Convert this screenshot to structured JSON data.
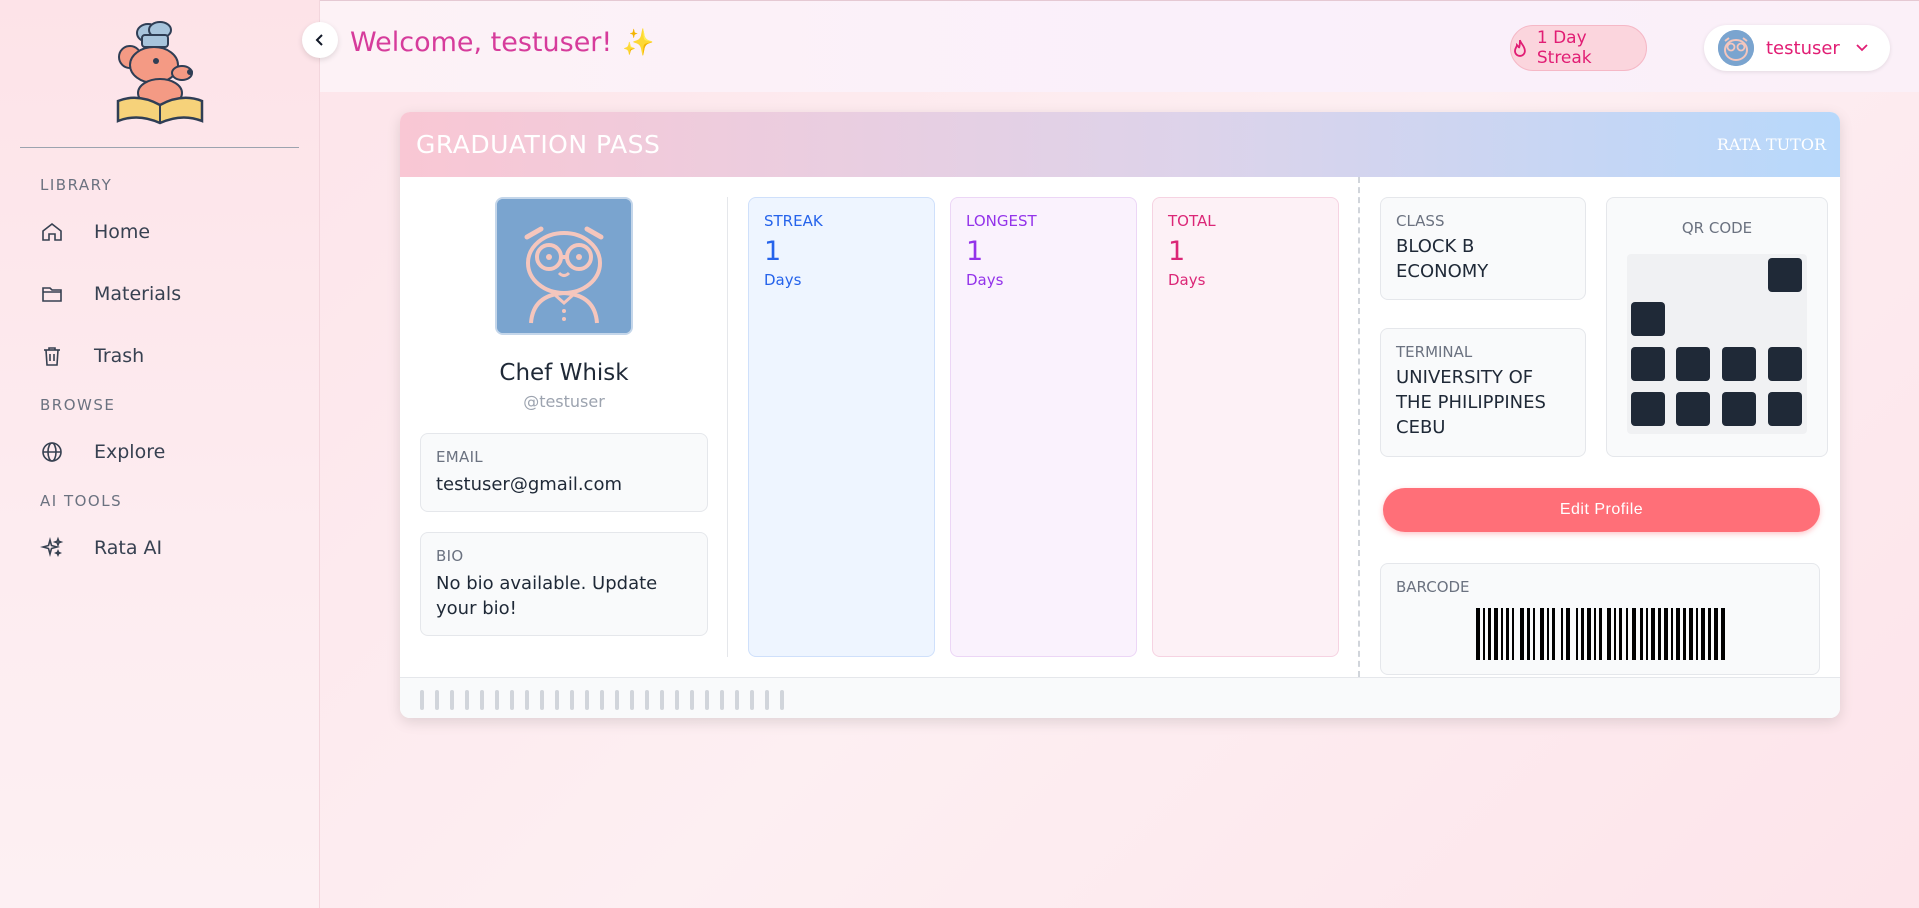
{
  "sidebar": {
    "sections": [
      {
        "heading": "LIBRARY",
        "items": [
          {
            "label": "Home",
            "icon": "home-icon"
          },
          {
            "label": "Materials",
            "icon": "folder-icon"
          },
          {
            "label": "Trash",
            "icon": "trash-icon"
          }
        ]
      },
      {
        "heading": "BROWSE",
        "items": [
          {
            "label": "Explore",
            "icon": "globe-icon"
          }
        ]
      },
      {
        "heading": "AI TOOLS",
        "items": [
          {
            "label": "Rata AI",
            "icon": "sparkles-icon"
          }
        ]
      }
    ]
  },
  "header": {
    "welcome": "Welcome, testuser!",
    "sparkle": "✨",
    "streak": "1 Day Streak",
    "username": "testuser"
  },
  "pass": {
    "title": "GRADUATION PASS",
    "brand": "RATA TUTOR",
    "profile": {
      "name": "Chef Whisk",
      "handle": "@testuser",
      "email_label": "EMAIL",
      "email": "testuser@gmail.com",
      "bio_label": "BIO",
      "bio": "No bio available. Update your bio!"
    },
    "stats": [
      {
        "label": "STREAK",
        "value": "1",
        "unit": "Days"
      },
      {
        "label": "LONGEST",
        "value": "1",
        "unit": "Days"
      },
      {
        "label": "TOTAL",
        "value": "1",
        "unit": "Days"
      }
    ],
    "class_label": "CLASS",
    "class_value": "BLOCK B ECONOMY",
    "terminal_label": "TERMINAL",
    "terminal_value": "UNIVERSITY OF THE PHILIPPINES CEBU",
    "qr_label": "QR CODE",
    "edit_button": "Edit Profile",
    "barcode_label": "BARCODE"
  },
  "colors": {
    "accent_pink": "#e11d74",
    "edit_button": "#ff6f78",
    "streak_blue": "#2563eb",
    "longest_purple": "#9333ea",
    "total_pink": "#db2777"
  }
}
